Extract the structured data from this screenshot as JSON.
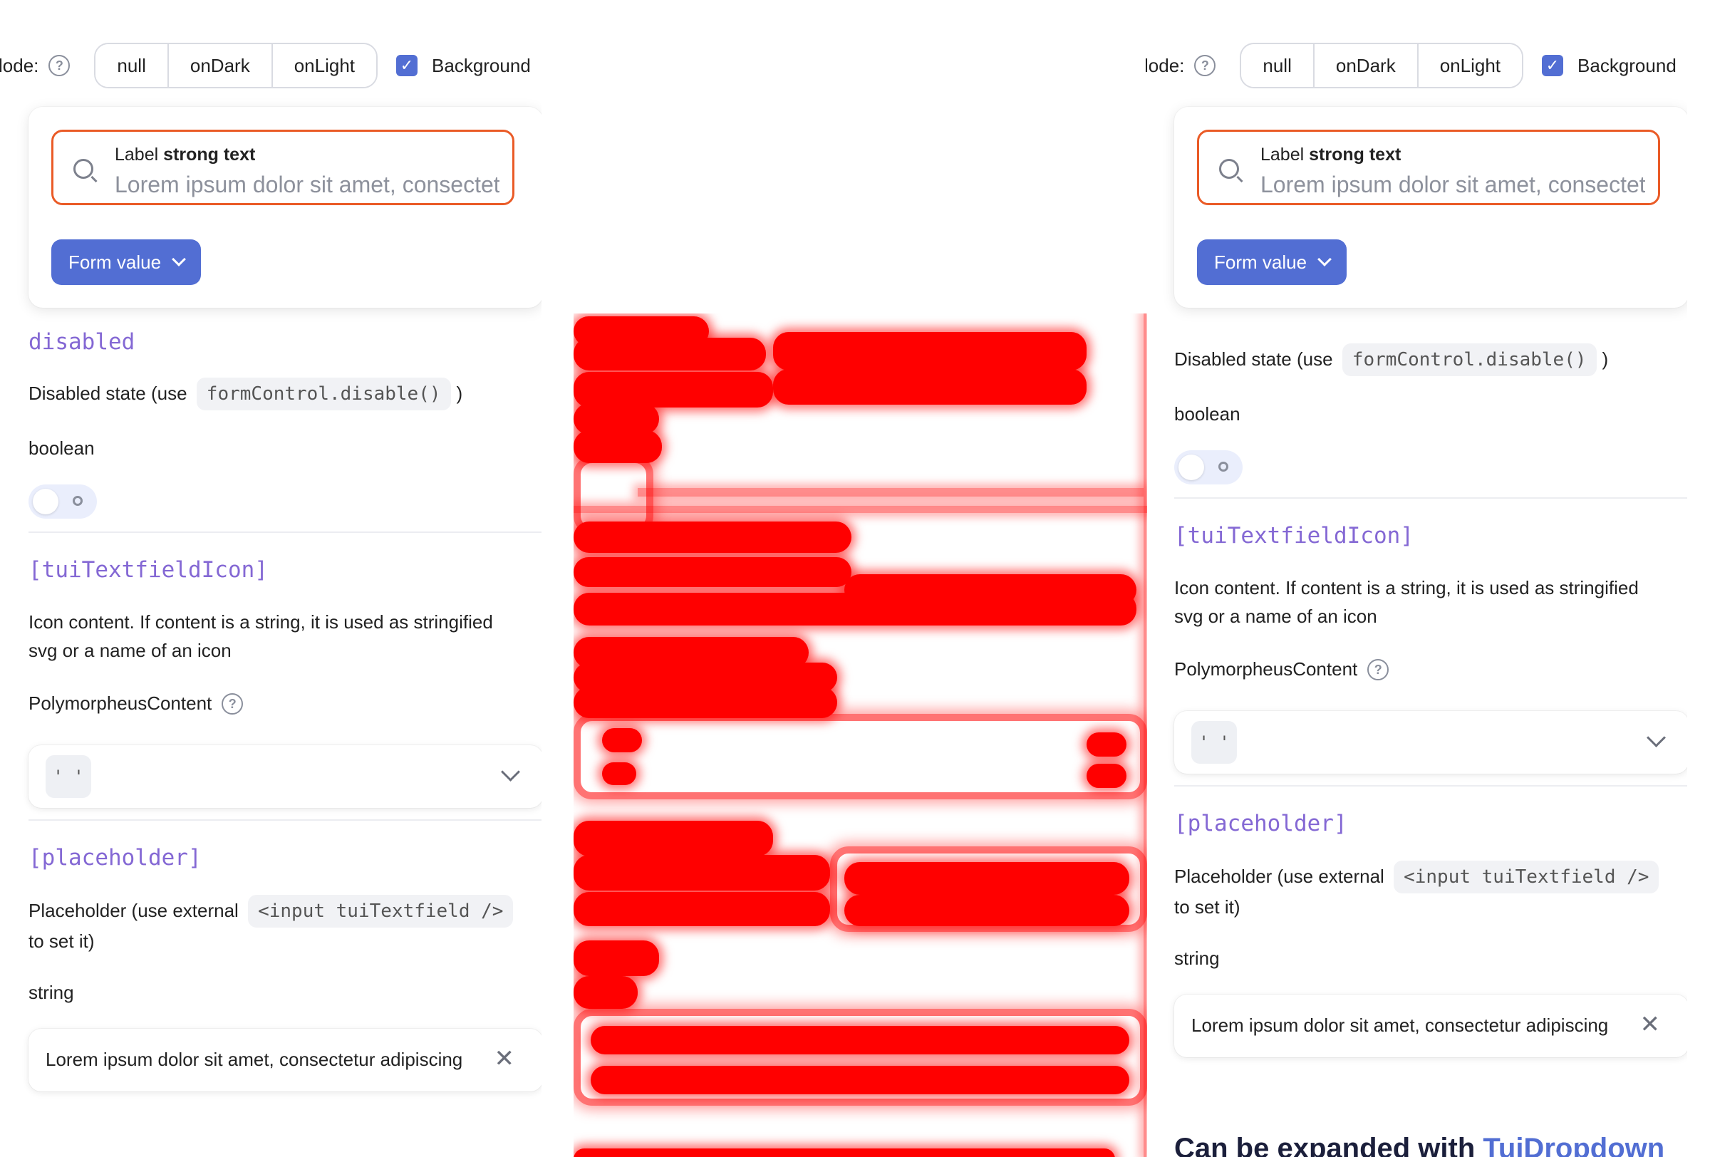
{
  "demo": {
    "mode_label": "lode:",
    "modes": [
      "null",
      "onDark",
      "onLight"
    ],
    "background_label": "Background",
    "textfield": {
      "label_prefix": "Label",
      "label_strong": "strong text",
      "placeholder": "Lorem ipsum dolor sit amet, consectetur adipiscing"
    },
    "form_button": "Form value"
  },
  "docs": {
    "disabled": {
      "title": "disabled",
      "desc_prefix": "Disabled state (use",
      "code": "formControl.disable()",
      "desc_suffix": ")",
      "type": "boolean"
    },
    "icon": {
      "title": "[tuiTextfieldIcon]",
      "desc_line1": "Icon content. If content is a string, it is used as stringified",
      "desc_line2": "svg or a name of an icon",
      "type": "PolymorpheusContent",
      "select_value": "' '"
    },
    "placeholder": {
      "title": "[placeholder]",
      "desc_prefix": "Placeholder (use external",
      "code": "<input tuiTextfield />",
      "desc_line2": "to set it)",
      "type": "string",
      "value": "Lorem ipsum dolor sit amet, consectetur adipiscing"
    }
  },
  "section_heading": {
    "prefix": "Can be expanded with",
    "link": "TuiDropdown"
  },
  "colors": {
    "accent": "#526ed3",
    "focus_border": "#ea5b27",
    "mono_title": "#8468d4",
    "redaction": "#ff0000"
  }
}
